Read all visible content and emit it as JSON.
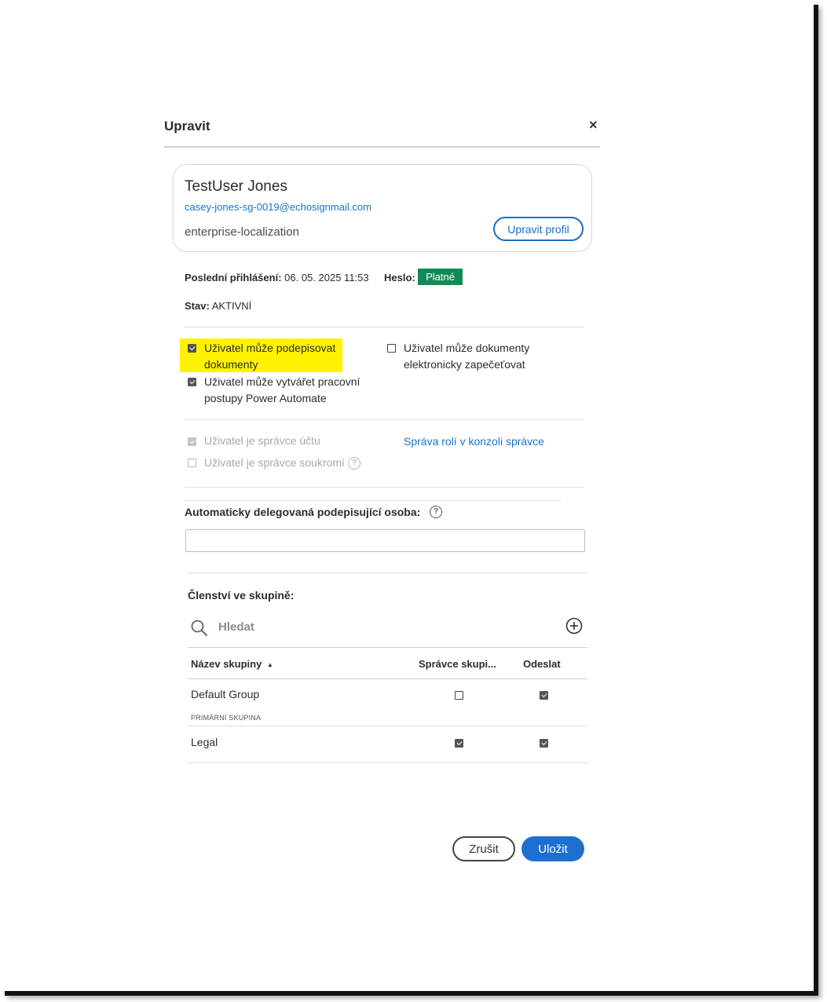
{
  "dialog": {
    "title": "Upravit",
    "close_glyph": "×"
  },
  "user": {
    "name": "TestUser Jones",
    "email": "casey-jones-sg-0019@echosignmail.com",
    "org": "enterprise-localization",
    "edit_profile_label": "Upravit profil"
  },
  "status": {
    "last_login_label": "Poslední přihlášení:",
    "last_login_value": "06. 05. 2025 11:53",
    "password_label": "Heslo:",
    "password_badge": "Platné",
    "state_label": "Stav:",
    "state_value": "AKTIVNÍ"
  },
  "permissions": [
    {
      "label_line1": "Uživatel může podepisovat",
      "label_line2": "dokumenty",
      "checked": true
    },
    {
      "label_line1": "Uživatel může vytvářet pracovní",
      "label_line2": "postupy Power Automate",
      "checked": true
    },
    {
      "label_line1": "Uživatel může dokumenty",
      "label_line2": "elektronicky zapečeťovat",
      "checked": false
    }
  ],
  "roles": {
    "account_admin_label": "Uživatel je správce účtu",
    "privacy_admin_label": "Uživatel je správce soukromí",
    "manage_roles_link": "Správa rolí v konzoli správce"
  },
  "delegation": {
    "label": "Automaticky delegovaná podepisující osoba:",
    "value": ""
  },
  "groups": {
    "section_label": "Členství ve skupině:",
    "search_placeholder": "Hledat",
    "columns": {
      "name": "Název skupiny",
      "admin": "Správce skupi...",
      "send": "Odeslat"
    },
    "rows": [
      {
        "name": "Default Group",
        "subtitle": "PRIMÁRNÍ SKUPINA",
        "admin": false,
        "send": true
      },
      {
        "name": "Legal",
        "subtitle": "",
        "admin": true,
        "send": true
      }
    ]
  },
  "footer": {
    "cancel_label": "Zrušit",
    "save_label": "Uložit"
  },
  "colors": {
    "accent": "#1f6fd1",
    "badge_green": "#138a56",
    "highlight": "#fff200"
  }
}
